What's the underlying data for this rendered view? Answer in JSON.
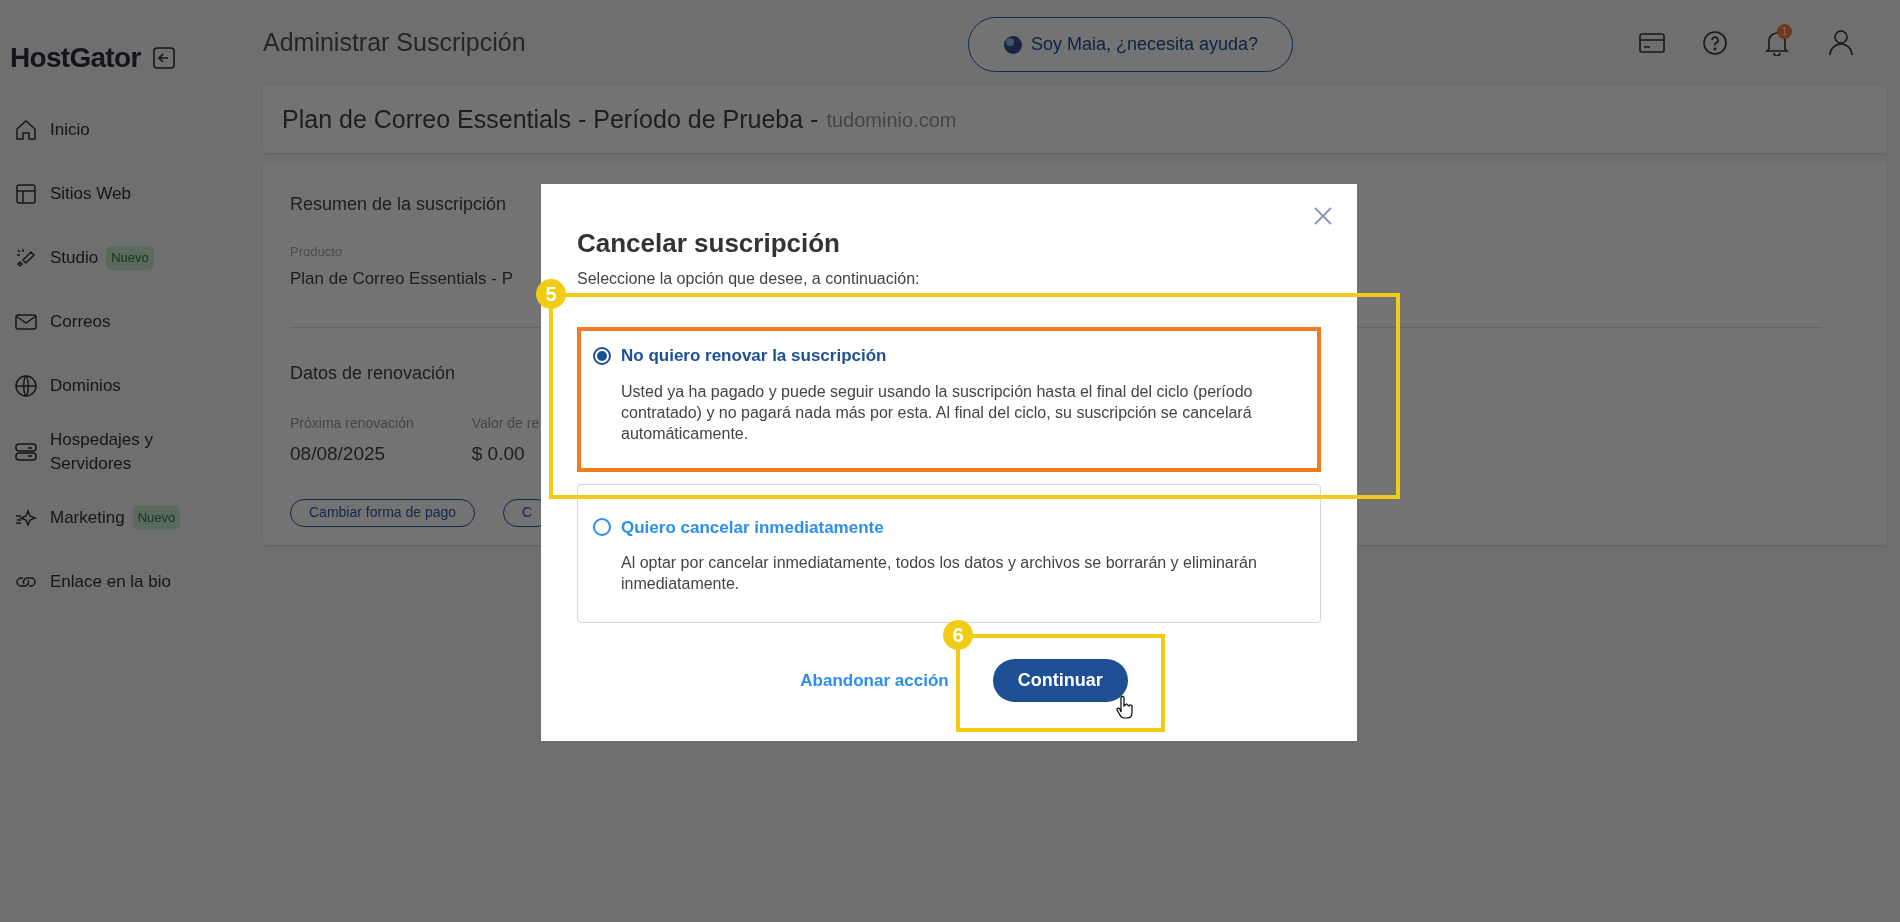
{
  "app": {
    "logo": "HostGator",
    "page_title": "Administrar Suscripción",
    "assistant_button": "Soy Maia, ¿necesita ayuda?",
    "notification_count": "1"
  },
  "sidebar": {
    "items": [
      {
        "label": "Inicio"
      },
      {
        "label": "Sitios Web"
      },
      {
        "label": "Studio",
        "badge": "Nuevo"
      },
      {
        "label": "Correos"
      },
      {
        "label": "Dominios"
      },
      {
        "label": "Hospedajes y Servidores"
      },
      {
        "label": "Marketing",
        "badge": "Nuevo"
      },
      {
        "label": "Enlace en la bio"
      }
    ]
  },
  "plan_bar": {
    "title": "Plan de Correo Essentials - Período de Prueba -",
    "domain": "tudominio.com"
  },
  "summary_card": {
    "title": "Resumen de la suscripción",
    "product_label": "Producto",
    "product_value": "Plan de Correo Essentials - P",
    "renewal_title": "Datos de renovación",
    "fields": [
      {
        "label": "Próxima renovación",
        "value": "08/08/2025"
      },
      {
        "label": "Valor de re",
        "value": "$ 0.00"
      }
    ],
    "buttons": [
      "Cambiar forma de pago",
      "C"
    ]
  },
  "modal": {
    "title": "Cancelar suscripción",
    "subtitle": "Seleccione la opción que desee, a continuación:",
    "options": [
      {
        "title": "No quiero renovar la suscripción",
        "description": "Usted ya ha pagado y puede seguir usando la suscripción hasta el final del ciclo (período contratado) y no pagará nada más por esta. Al final del ciclo, su suscripción se cancelará automáticamente.",
        "selected": true
      },
      {
        "title": "Quiero cancelar inmediatamente",
        "description": "Al optar por cancelar inmediatamente, todos los datos y archivos se borrarán y eliminarán inmediatamente.",
        "selected": false
      }
    ],
    "secondary_action": "Abandonar acción",
    "primary_action": "Continuar"
  },
  "annotations": [
    {
      "label": "5"
    },
    {
      "label": "6"
    }
  ]
}
